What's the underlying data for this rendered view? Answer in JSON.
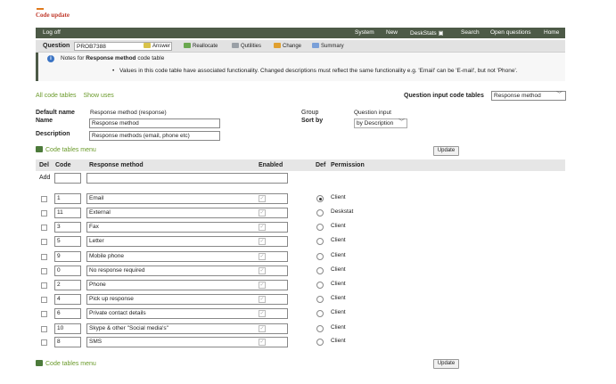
{
  "app": {
    "title": "Code update"
  },
  "topbar": {
    "logoff": "Log off",
    "menu": [
      "System",
      "New",
      "DeskStats",
      "Search",
      "Open questions",
      "Home"
    ]
  },
  "question": {
    "label": "Question",
    "value": "PROB7388",
    "tools": [
      {
        "label": "Answer",
        "color": "#d8c24a"
      },
      {
        "label": "Reallocate",
        "color": "#6aa84f"
      },
      {
        "label": "Qutilities",
        "color": "#9aa0a6"
      },
      {
        "label": "Change",
        "color": "#e0a030"
      },
      {
        "label": "Summary",
        "color": "#7aa0d8"
      }
    ]
  },
  "notes": {
    "prefix": "Notes for ",
    "bold": "Response method",
    "suffix": " code table",
    "bullet": "•",
    "text": "Values in this code table have associated functionality. Changed descriptions must reflect the same functionality e.g. 'Email' can be 'E-mail', but not 'Phone'."
  },
  "tabs": {
    "all": "All code tables",
    "show_uses": "Show uses"
  },
  "qict": {
    "label": "Question input code tables",
    "selected": "Response method"
  },
  "form": {
    "default_name_label": "Default name",
    "default_name_value": "Response method (response)",
    "name_label": "Name",
    "name_value": "Response method",
    "description_label": "Description",
    "description_value": "Response methods (email, phone etc)",
    "group_label": "Group",
    "group_value": "Question input",
    "sortby_label": "Sort by",
    "sortby_value": "by Description"
  },
  "menu_link": "Code tables menu",
  "update_label": "Update",
  "table": {
    "headers": {
      "del": "Del",
      "code": "Code",
      "method": "Response method",
      "enabled": "Enabled",
      "def": "Def",
      "permission": "Permission"
    },
    "add_label": "Add",
    "rows": [
      {
        "code": "1",
        "name": "Email",
        "def": true,
        "perm": "Client"
      },
      {
        "code": "11",
        "name": "External",
        "def": false,
        "perm": "Deskstat"
      },
      {
        "code": "3",
        "name": "Fax",
        "def": false,
        "perm": "Client"
      },
      {
        "code": "5",
        "name": "Letter",
        "def": false,
        "perm": "Client"
      },
      {
        "code": "9",
        "name": "Mobile phone",
        "def": false,
        "perm": "Client"
      },
      {
        "code": "0",
        "name": "No response required",
        "def": false,
        "perm": "Client"
      },
      {
        "code": "2",
        "name": "Phone",
        "def": false,
        "perm": "Client"
      },
      {
        "code": "4",
        "name": "Pick up response",
        "def": false,
        "perm": "Client"
      },
      {
        "code": "6",
        "name": "Private contact details",
        "def": false,
        "perm": "Client"
      },
      {
        "code": "10",
        "name": "Skype & other \"Social media's\"",
        "def": false,
        "perm": "Client"
      },
      {
        "code": "8",
        "name": "SMS",
        "def": false,
        "perm": "Client"
      }
    ]
  }
}
